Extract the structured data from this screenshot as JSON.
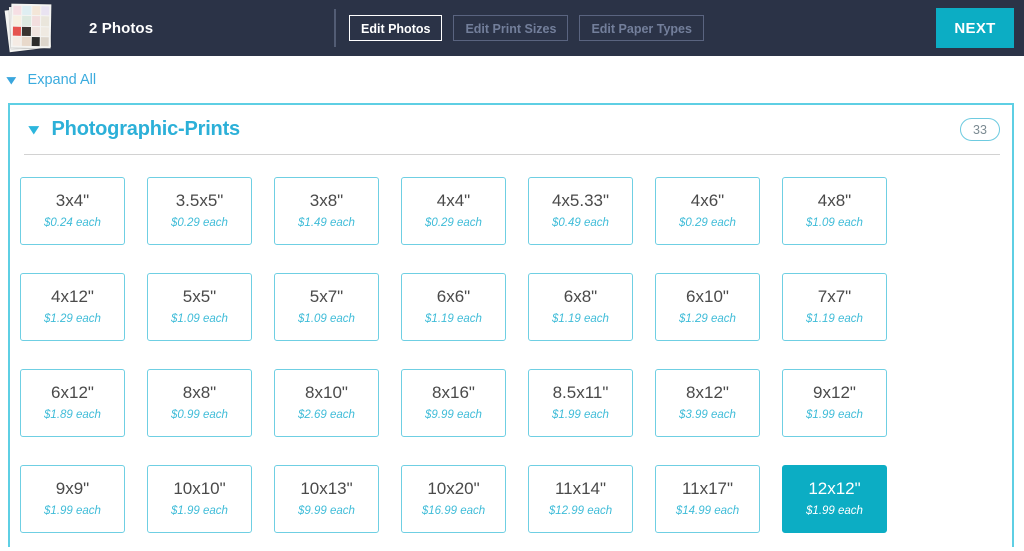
{
  "header": {
    "thumbnail_icon": "photo-stack-icon",
    "photos_count_label": "2 Photos",
    "buttons": [
      {
        "label": "Edit Photos",
        "active": true
      },
      {
        "label": "Edit Print Sizes",
        "active": false
      },
      {
        "label": "Edit Paper Types",
        "active": false
      }
    ],
    "next_label": "NEXT",
    "background_color": "#2b3347",
    "accent_color": "#0cadc4"
  },
  "expand": {
    "label": "Expand All",
    "chevron_icon": "chevron-down-icon"
  },
  "panel": {
    "chevron_icon": "chevron-down-icon",
    "title": "Photographic-Prints",
    "count_badge": "33",
    "border_color": "#5ecfe4",
    "title_color": "#2cb0d8"
  },
  "tiles": [
    {
      "size": "3x4\"",
      "price": "$0.24 each",
      "selected": false
    },
    {
      "size": "3.5x5\"",
      "price": "$0.29 each",
      "selected": false
    },
    {
      "size": "3x8\"",
      "price": "$1.49 each",
      "selected": false
    },
    {
      "size": "4x4\"",
      "price": "$0.29 each",
      "selected": false
    },
    {
      "size": "4x5.33\"",
      "price": "$0.49 each",
      "selected": false
    },
    {
      "size": "4x6\"",
      "price": "$0.29 each",
      "selected": false
    },
    {
      "size": "4x8\"",
      "price": "$1.09 each",
      "selected": false
    },
    {
      "size": "4x12\"",
      "price": "$1.29 each",
      "selected": false
    },
    {
      "size": "5x5\"",
      "price": "$1.09 each",
      "selected": false
    },
    {
      "size": "5x7\"",
      "price": "$1.09 each",
      "selected": false
    },
    {
      "size": "6x6\"",
      "price": "$1.19 each",
      "selected": false
    },
    {
      "size": "6x8\"",
      "price": "$1.19 each",
      "selected": false
    },
    {
      "size": "6x10\"",
      "price": "$1.29 each",
      "selected": false
    },
    {
      "size": "7x7\"",
      "price": "$1.19 each",
      "selected": false
    },
    {
      "size": "6x12\"",
      "price": "$1.89 each",
      "selected": false
    },
    {
      "size": "8x8\"",
      "price": "$0.99 each",
      "selected": false
    },
    {
      "size": "8x10\"",
      "price": "$2.69 each",
      "selected": false
    },
    {
      "size": "8x16\"",
      "price": "$9.99 each",
      "selected": false
    },
    {
      "size": "8.5x11\"",
      "price": "$1.99 each",
      "selected": false
    },
    {
      "size": "8x12\"",
      "price": "$3.99 each",
      "selected": false
    },
    {
      "size": "9x12\"",
      "price": "$1.99 each",
      "selected": false
    },
    {
      "size": "9x9\"",
      "price": "$1.99 each",
      "selected": false
    },
    {
      "size": "10x10\"",
      "price": "$1.99 each",
      "selected": false
    },
    {
      "size": "10x13\"",
      "price": "$9.99 each",
      "selected": false
    },
    {
      "size": "10x20\"",
      "price": "$16.99 each",
      "selected": false
    },
    {
      "size": "11x14\"",
      "price": "$12.99 each",
      "selected": false
    },
    {
      "size": "11x17\"",
      "price": "$14.99 each",
      "selected": false
    },
    {
      "size": "12x12\"",
      "price": "$1.99 each",
      "selected": true
    }
  ],
  "thumbnail_colors": [
    "#f6dfe4",
    "#dfeef2",
    "#f3e6d8",
    "#e9e3f1",
    "#f7f0e2",
    "#dde9e0",
    "#f2dede",
    "#eae6dc",
    "#e5534f",
    "#3a3430",
    "#f0e4df",
    "#efeae2",
    "#f5ebe4",
    "#e8d9cb",
    "#2c2c2c",
    "#ddd6cc"
  ]
}
